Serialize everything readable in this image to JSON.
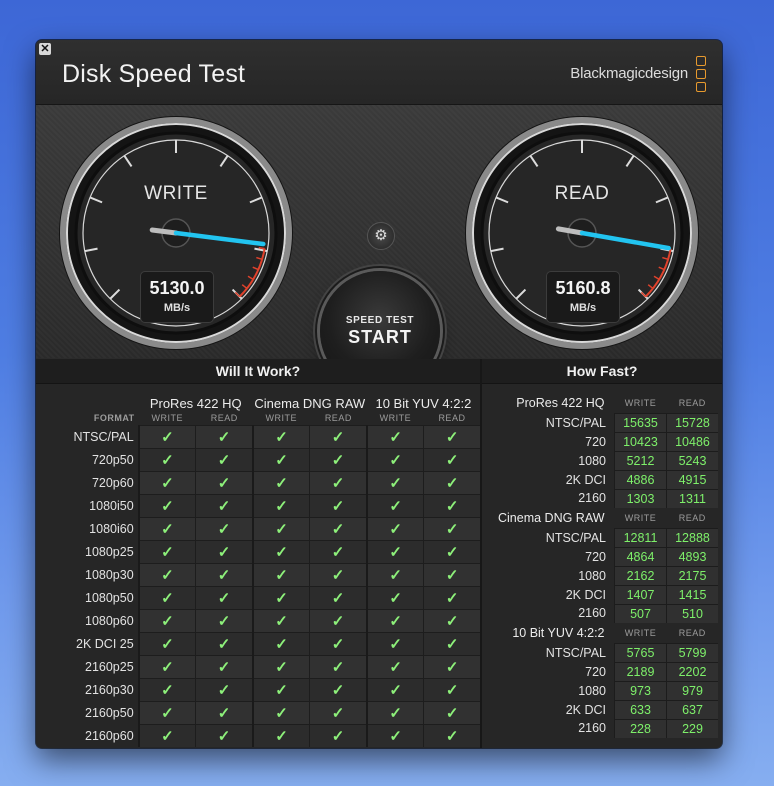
{
  "window": {
    "title": "Disk Speed Test",
    "brand": "Blackmagicdesign",
    "close_symbol": "✕"
  },
  "gauges": {
    "write": {
      "label": "WRITE",
      "value": "5130.0",
      "unit": "MB/s",
      "level": 0.86
    },
    "read": {
      "label": "READ",
      "value": "5160.8",
      "unit": "MB/s",
      "level": 0.87
    }
  },
  "controls": {
    "settings_icon": "gear-icon",
    "start_top": "SPEED TEST",
    "start_main": "START"
  },
  "will_it_work": {
    "title": "Will It Work?",
    "format_header": "FORMAT",
    "write_label": "WRITE",
    "read_label": "READ",
    "check": "✓",
    "groups": [
      "ProRes 422 HQ",
      "Cinema DNG RAW",
      "10 Bit YUV 4:2:2"
    ],
    "formats": [
      "NTSC/PAL",
      "720p50",
      "720p60",
      "1080i50",
      "1080i60",
      "1080p25",
      "1080p30",
      "1080p50",
      "1080p60",
      "2K DCI 25",
      "2160p25",
      "2160p30",
      "2160p50",
      "2160p60"
    ]
  },
  "how_fast": {
    "title": "How Fast?",
    "write_label": "WRITE",
    "read_label": "READ",
    "groups": [
      {
        "name": "ProRes 422 HQ",
        "rows": [
          {
            "format": "NTSC/PAL",
            "write": "15635",
            "read": "15728"
          },
          {
            "format": "720",
            "write": "10423",
            "read": "10486"
          },
          {
            "format": "1080",
            "write": "5212",
            "read": "5243"
          },
          {
            "format": "2K DCI",
            "write": "4886",
            "read": "4915"
          },
          {
            "format": "2160",
            "write": "1303",
            "read": "1311"
          }
        ]
      },
      {
        "name": "Cinema DNG RAW",
        "rows": [
          {
            "format": "NTSC/PAL",
            "write": "12811",
            "read": "12888"
          },
          {
            "format": "720",
            "write": "4864",
            "read": "4893"
          },
          {
            "format": "1080",
            "write": "2162",
            "read": "2175"
          },
          {
            "format": "2K DCI",
            "write": "1407",
            "read": "1415"
          },
          {
            "format": "2160",
            "write": "507",
            "read": "510"
          }
        ]
      },
      {
        "name": "10 Bit YUV 4:2:2",
        "rows": [
          {
            "format": "NTSC/PAL",
            "write": "5765",
            "read": "5799"
          },
          {
            "format": "720",
            "write": "2189",
            "read": "2202"
          },
          {
            "format": "1080",
            "write": "973",
            "read": "979"
          },
          {
            "format": "2K DCI",
            "write": "633",
            "read": "637"
          },
          {
            "format": "2160",
            "write": "228",
            "read": "229"
          }
        ]
      }
    ]
  }
}
